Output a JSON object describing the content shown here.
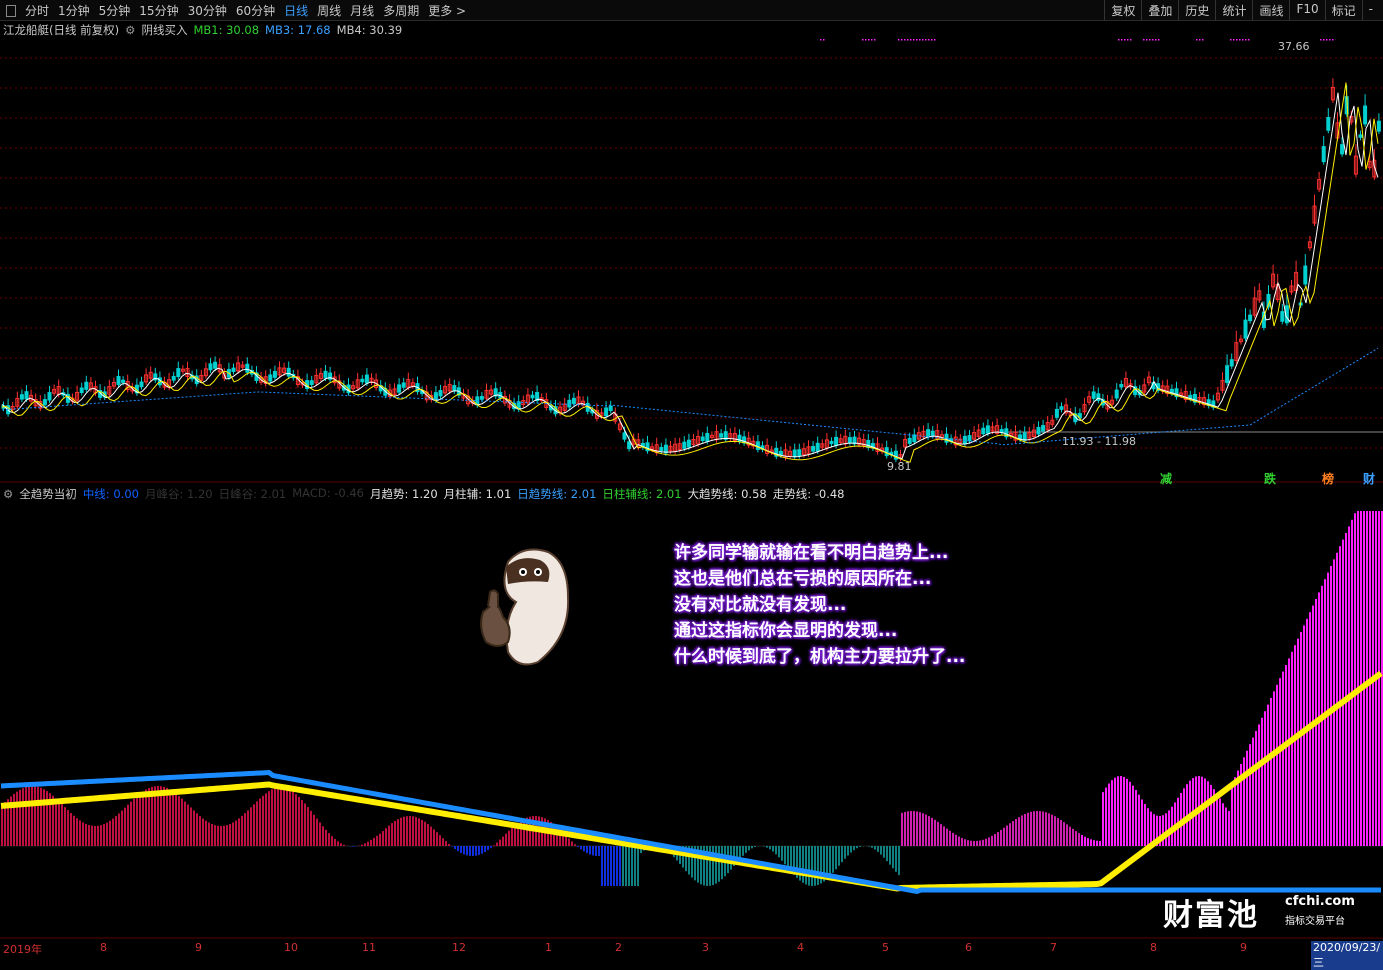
{
  "toolbar": {
    "left_items": [
      "分时",
      "1分钟",
      "5分钟",
      "15分钟",
      "30分钟",
      "60分钟",
      "日线",
      "周线",
      "月线",
      "多周期",
      "更多 >"
    ],
    "active_item": "日线",
    "right_items": [
      "复权",
      "叠加",
      "历史",
      "统计",
      "画线",
      "F10",
      "标记",
      "-"
    ]
  },
  "main_header": {
    "title": "江龙船艇(日线 前复权)",
    "indicator": "阴线买入",
    "mb1": "MB1: 30.08",
    "mb3": "MB3: 17.68",
    "mb4": "MB4: 30.39"
  },
  "main_chart": {
    "high_label": "37.66",
    "low_label": "9.81",
    "range_label": "11.93 - 11.98"
  },
  "flags": [
    "减",
    "跌",
    "榜",
    "财"
  ],
  "sub_header": {
    "title": "全趋势当初",
    "items": [
      {
        "text": "中线: 0.00",
        "color": "#1060ff"
      },
      {
        "text": "月峰谷: 1.20",
        "color": "#333333"
      },
      {
        "text": "日峰谷: 2.01",
        "color": "#333333"
      },
      {
        "text": "MACD: -0.46",
        "color": "#333333"
      },
      {
        "text": "月趋势: 1.20",
        "color": "#e0e0e0"
      },
      {
        "text": "月柱辅: 1.01",
        "color": "#e0e0e0"
      },
      {
        "text": "日趋势线: 2.01",
        "color": "#3aa0ff"
      },
      {
        "text": "日柱辅线: 2.01",
        "color": "#30d030"
      },
      {
        "text": "大趋势线: 0.58",
        "color": "#e0e0e0"
      },
      {
        "text": "走势线: -0.48",
        "color": "#e0e0e0"
      }
    ]
  },
  "overlay_lines": [
    "许多同学输就输在看不明白趋势上...",
    "这也是他们总在亏损的原因所在...",
    "没有对比就没有发现...",
    "通过这指标你会显明的发现...",
    "什么时候到底了，机构主力要拉升了..."
  ],
  "x_axis": [
    "2019年",
    "8",
    "9",
    "10",
    "11",
    "12",
    "1",
    "2",
    "3",
    "4",
    "5",
    "6",
    "7",
    "8",
    "9",
    "2020/09/23/三"
  ],
  "logo": {
    "name": "财富池",
    "site": "cfchi.com",
    "slogan": "指标交易平台"
  },
  "colors": {
    "up": "#ff3030",
    "down": "#00d0d0",
    "ma_white": "#ffffff",
    "ma_yellow": "#ffee00",
    "ma_blue": "#1a8cff",
    "magenta": "#ff20ff",
    "grid": "#6a0000"
  }
}
